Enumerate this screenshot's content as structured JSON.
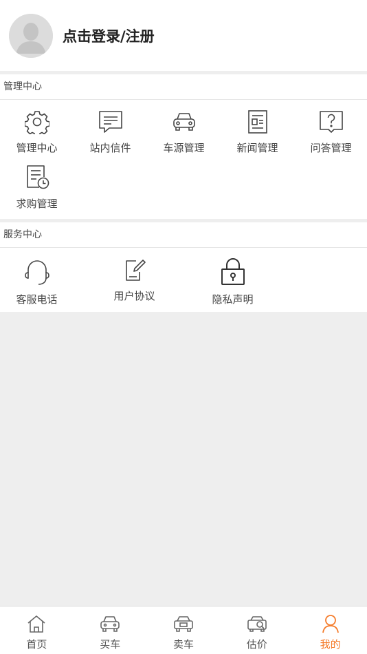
{
  "profile": {
    "login_label": "点击登录/注册"
  },
  "management": {
    "title": "管理中心",
    "items": [
      {
        "label": "管理中心",
        "icon": "gear-icon"
      },
      {
        "label": "站内信件",
        "icon": "message-icon"
      },
      {
        "label": "车源管理",
        "icon": "car-icon"
      },
      {
        "label": "新闻管理",
        "icon": "news-icon"
      },
      {
        "label": "问答管理",
        "icon": "question-icon"
      },
      {
        "label": "求购管理",
        "icon": "purchase-icon"
      }
    ]
  },
  "service": {
    "title": "服务中心",
    "items": [
      {
        "label": "客服电话",
        "icon": "headset-icon"
      },
      {
        "label": "用户协议",
        "icon": "agreement-icon"
      },
      {
        "label": "隐私声明",
        "icon": "lock-icon"
      }
    ]
  },
  "tabbar": {
    "items": [
      {
        "label": "首页",
        "icon": "home-icon"
      },
      {
        "label": "买车",
        "icon": "car-icon"
      },
      {
        "label": "卖车",
        "icon": "sell-car-icon"
      },
      {
        "label": "估价",
        "icon": "valuation-icon"
      },
      {
        "label": "我的",
        "icon": "user-icon"
      }
    ],
    "active_index": 4,
    "active_color": "#f57c2b"
  }
}
